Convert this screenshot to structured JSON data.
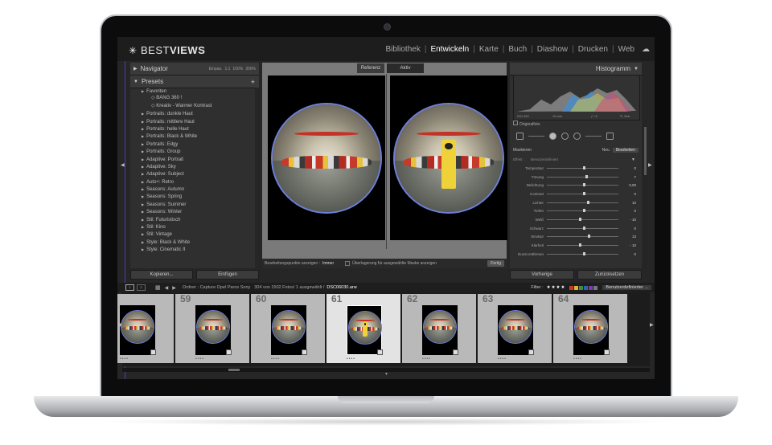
{
  "app": {
    "logo_light": "BEST",
    "logo_bold": "VIEWS",
    "modules": [
      {
        "label": "Bibliothek",
        "active": false
      },
      {
        "label": "Entwickeln",
        "active": true
      },
      {
        "label": "Karte",
        "active": false
      },
      {
        "label": "Buch",
        "active": false
      },
      {
        "label": "Diashow",
        "active": false
      },
      {
        "label": "Drucken",
        "active": false
      },
      {
        "label": "Web",
        "active": false
      }
    ]
  },
  "left_panel": {
    "navigator": "Navigator",
    "zoom_options": [
      "Einpas.",
      "1:1",
      "100%",
      "300%"
    ],
    "presets_title": "Presets",
    "preset_items": [
      {
        "label": "Favoriten",
        "sub": false
      },
      {
        "label": "BANG 360 !",
        "sub": true
      },
      {
        "label": "Kreativ - Warmer Kontrast",
        "sub": true
      },
      {
        "label": "Portraits: dunkle Haut",
        "sub": false
      },
      {
        "label": "Portraits: mittlere Haut",
        "sub": false
      },
      {
        "label": "Portraits: helle Haut",
        "sub": false
      },
      {
        "label": "Portraits: Black & White",
        "sub": false
      },
      {
        "label": "Portraits: Edgy",
        "sub": false
      },
      {
        "label": "Portraits: Group",
        "sub": false
      },
      {
        "label": "Adaptive: Portrait",
        "sub": false
      },
      {
        "label": "Adaptive: Sky",
        "sub": false
      },
      {
        "label": "Adaptive: Subject",
        "sub": false
      },
      {
        "label": "Auto+: Retro",
        "sub": false
      },
      {
        "label": "Seasons: Autumn",
        "sub": false
      },
      {
        "label": "Seasons: Spring",
        "sub": false
      },
      {
        "label": "Seasons: Summer",
        "sub": false
      },
      {
        "label": "Seasons: Winter",
        "sub": false
      },
      {
        "label": "Stil: Futuristisch",
        "sub": false
      },
      {
        "label": "Stil: Kino",
        "sub": false
      },
      {
        "label": "Stil: Vintage",
        "sub": false
      },
      {
        "label": "Style: Black & White",
        "sub": false
      },
      {
        "label": "Style: Cinematic II",
        "sub": false
      }
    ],
    "copy_button": "Kopieren...",
    "paste_button": "Einfügen"
  },
  "center": {
    "tab_reference": "Referenz",
    "tab_active": "Aktiv",
    "bottom_label": "Bearbeitungspunkte anzeigen :",
    "bottom_value": "Immer",
    "overlay_label": "Überlagerung für ausgewählte Maske anzeigen",
    "done_button": "Fertig"
  },
  "right_panel": {
    "histogram_title": "Histogramm",
    "histo_labels": [
      "ISO 400",
      "10 mm",
      "ƒ / 8",
      "⅕ Sek."
    ],
    "original_photo": "Originalfoto",
    "mask_label": "Maskieren",
    "mask_new": "Neu",
    "mask_edit": "Bearbeiten",
    "effect_label": "Effekt :",
    "effect_value": "Benutzerdefiniert",
    "sliders": [
      {
        "label": "Temperatur",
        "value": "0",
        "pos": 0.5
      },
      {
        "label": "Tönung",
        "value": "7",
        "pos": 0.54
      },
      {
        "label": "Belichtung",
        "value": "0,00",
        "pos": 0.5
      },
      {
        "label": "Kontrast",
        "value": "0",
        "pos": 0.5
      },
      {
        "label": "Lichter",
        "value": "10",
        "pos": 0.56
      },
      {
        "label": "Tiefen",
        "value": "0",
        "pos": 0.5
      },
      {
        "label": "Weiß",
        "value": "- 10",
        "pos": 0.45
      },
      {
        "label": "Schwarz",
        "value": "0",
        "pos": 0.5
      },
      {
        "label": "Struktur",
        "value": "13",
        "pos": 0.57
      },
      {
        "label": "Klarheit",
        "value": "- 10",
        "pos": 0.45
      },
      {
        "label": "Dunst entfernen",
        "value": "0",
        "pos": 0.5
      }
    ],
    "previous_button": "Vorherige",
    "reset_button": "Zurücksetzen"
  },
  "filmstrip": {
    "monitor1": "1",
    "monitor2": "2",
    "path_prefix": "Ordner : Capture Opel Paros Sony",
    "count_text": "304 von 1502 Fotos/ 1 ausgewählt /",
    "filename": "DSC06030.arw",
    "filter_label": "Filter :",
    "stars": "★★★★",
    "custom_filter": "Benutzerdefinierter ...",
    "thumb_numbers": [
      "",
      "59",
      "60",
      "61",
      "62",
      "63",
      "64"
    ],
    "selected_index": 3,
    "rating_dots": "••••"
  },
  "colors": {
    "accent": "#6d7fd8",
    "label_colors": [
      "#c7392f",
      "#d8b734",
      "#3f8d3c",
      "#3b5fb8",
      "#7a3ea3",
      "#777777"
    ]
  }
}
